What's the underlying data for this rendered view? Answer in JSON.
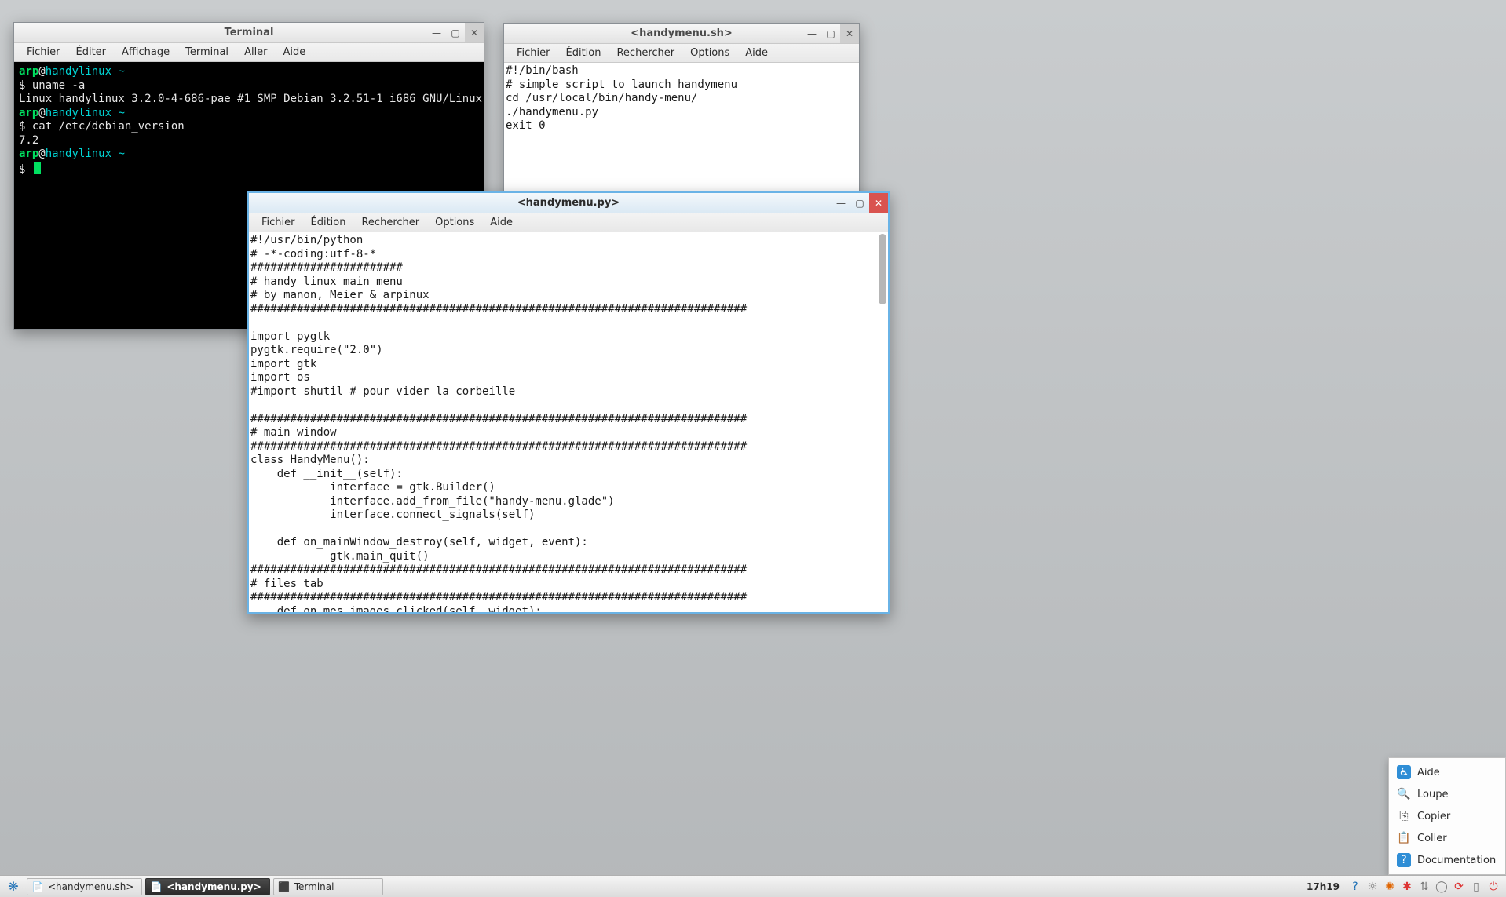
{
  "desktop": {
    "accent": "#6ab3e6"
  },
  "terminal": {
    "title": "Terminal",
    "menu": [
      "Fichier",
      "Éditer",
      "Affichage",
      "Terminal",
      "Aller",
      "Aide"
    ],
    "promptUser": "arp",
    "promptHost": "handylinux",
    "promptPath": "~",
    "cmd1": "$ uname -a",
    "out1": "Linux handylinux 3.2.0-4-686-pae #1 SMP Debian 3.2.51-1 i686 GNU/Linux",
    "cmd2": "$ cat /etc/debian_version",
    "out2": "7.2",
    "cmd3": "$ "
  },
  "editor_sh": {
    "title": "<handymenu.sh>",
    "menu": [
      "Fichier",
      "Édition",
      "Rechercher",
      "Options",
      "Aide"
    ],
    "content": "#!/bin/bash\n# simple script to launch handymenu\ncd /usr/local/bin/handy-menu/\n./handymenu.py\nexit 0"
  },
  "editor_py": {
    "title": "<handymenu.py>",
    "menu": [
      "Fichier",
      "Édition",
      "Rechercher",
      "Options",
      "Aide"
    ],
    "content": "#!/usr/bin/python\n# -*-coding:utf-8-*\n#######################\n# handy linux main menu\n# by manon, Meier & arpinux\n###########################################################################\n\nimport pygtk\npygtk.require(\"2.0\")\nimport gtk\nimport os\n#import shutil # pour vider la corbeille\n\n###########################################################################\n# main window\n###########################################################################\nclass HandyMenu():\n    def __init__(self):\n            interface = gtk.Builder()\n            interface.add_from_file(\"handy-menu.glade\")\n            interface.connect_signals(self)\n\n    def on_mainWindow_destroy(self, widget, event):\n            gtk.main_quit()\n###########################################################################\n# files tab\n###########################################################################\n    def on_mes_images_clicked(self, widget):\n            os.system(\"thunar $HOME/Images &\")\n            gtk.main_quit()\n\n    def on_mes_documents_clicked(self, widget):\n            os.system(\"thunar $HOME/Documents &\")\n            gtk.main_quit()"
  },
  "popup": {
    "items": [
      {
        "icon": "accessibility-icon",
        "label": "Aide"
      },
      {
        "icon": "magnifier-icon",
        "label": "Loupe"
      },
      {
        "icon": "copy-icon",
        "label": "Copier"
      },
      {
        "icon": "paste-icon",
        "label": "Coller"
      },
      {
        "icon": "help-icon",
        "label": "Documentation"
      }
    ]
  },
  "taskbar": {
    "tasks": [
      {
        "label": "<handymenu.sh>",
        "active": false
      },
      {
        "label": "<handymenu.py>",
        "active": true
      },
      {
        "label": "Terminal",
        "active": false
      }
    ],
    "clock": "17h19",
    "tray": [
      {
        "name": "help-icon",
        "glyph": "?",
        "cls": "blue"
      },
      {
        "name": "brightness-icon",
        "glyph": "☼",
        "cls": "gray"
      },
      {
        "name": "settings-icon",
        "glyph": "✺",
        "cls": "orange"
      },
      {
        "name": "bug-icon",
        "glyph": "✱",
        "cls": "red"
      },
      {
        "name": "network-icon",
        "glyph": "⇅",
        "cls": "gray"
      },
      {
        "name": "power-menu-icon",
        "glyph": "◯",
        "cls": "gray"
      },
      {
        "name": "update-icon",
        "glyph": "⟳",
        "cls": "red"
      },
      {
        "name": "clipboard-icon",
        "glyph": "▯",
        "cls": "gray"
      },
      {
        "name": "shutdown-icon",
        "glyph": "⏻",
        "cls": "red"
      }
    ]
  }
}
